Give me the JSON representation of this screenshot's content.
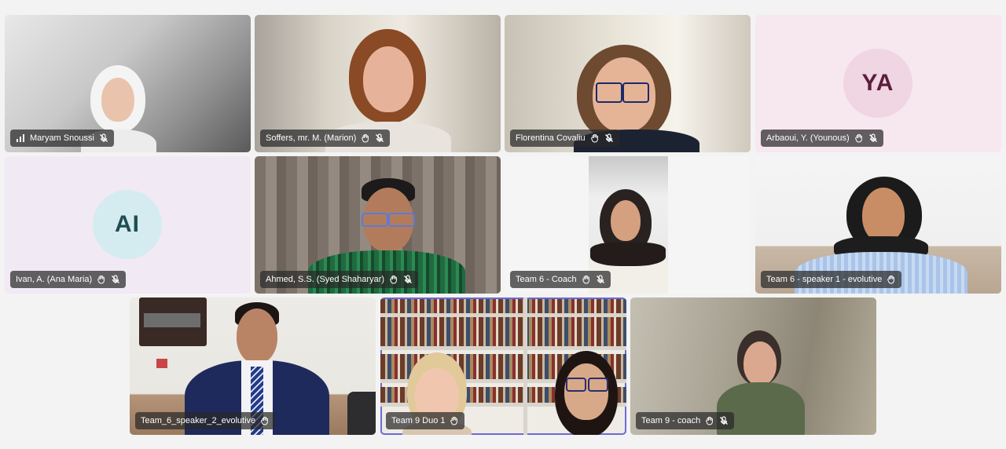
{
  "participants": [
    {
      "name": "Maryam Snoussi",
      "video": true
    },
    {
      "name": "Soffers, mr. M. (Marion)",
      "video": true
    },
    {
      "name": "Florentina Covaliu",
      "video": true
    },
    {
      "name": "Arbaoui, Y. (Younous)",
      "video": false,
      "initials": "YA"
    },
    {
      "name": "Ivan, A. (Ana Maria)",
      "video": false,
      "initials": "AI"
    },
    {
      "name": "Ahmed, S.S. (Syed Shaharyar)",
      "video": true
    },
    {
      "name": "Team 6 - Coach",
      "video": true
    },
    {
      "name": "Team 6 - speaker 1 - evolutive",
      "video": true
    },
    {
      "name": "Team_6_speaker_2_evolutive",
      "video": true
    },
    {
      "name": "Team 9 Duo 1",
      "video": true,
      "active_speaker": true
    },
    {
      "name": "Team 9 - coach",
      "video": true
    }
  ],
  "colors": {
    "avatar_ya_bg": "#f0d5e2",
    "avatar_ya_text": "#5a1f3d",
    "avatar_ai_bg": "#d4ecef",
    "avatar_ai_text": "#1f4d52",
    "active_outline": "#6b6bd6"
  },
  "icons": {
    "signal": "signal-bars-icon",
    "raise_hand": "hand-icon",
    "muted": "mic-off-icon"
  }
}
